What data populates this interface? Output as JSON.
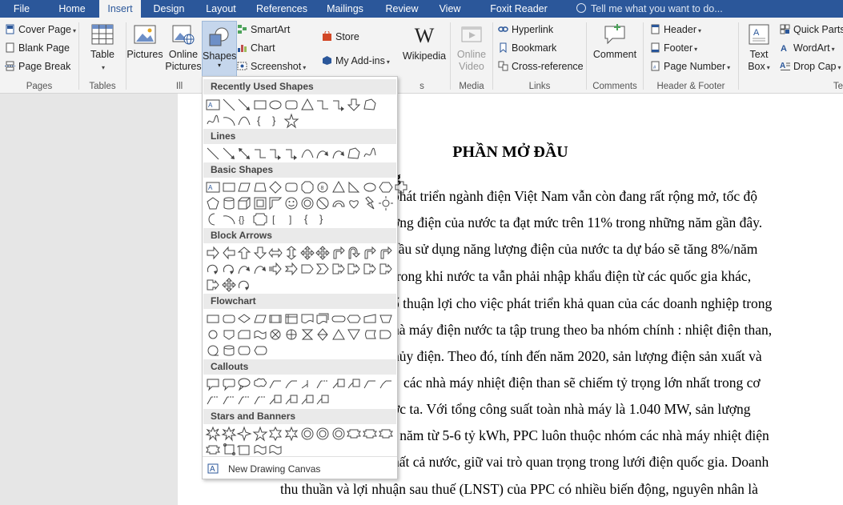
{
  "tabs": [
    "File",
    "Home",
    "Insert",
    "Design",
    "Layout",
    "References",
    "Mailings",
    "Review",
    "View",
    "Foxit Reader PDF"
  ],
  "tell_me": "Tell me what you want to do...",
  "ribbon": {
    "pages": {
      "label": "Pages",
      "cover_page": "Cover Page",
      "blank_page": "Blank Page",
      "page_break": "Page Break"
    },
    "tables": {
      "label": "Tables",
      "table": "Table"
    },
    "illustrations": {
      "label": "Ill",
      "pictures": "Pictures",
      "online_pictures_1": "Online",
      "online_pictures_2": "Pictures",
      "shapes": "Shapes",
      "smartart": "SmartArt",
      "chart": "Chart",
      "screenshot": "Screenshot"
    },
    "addins": {
      "store": "Store",
      "my_addins": "My Add-ins",
      "wikipedia": "Wikipedia",
      "label_tail": "s"
    },
    "media": {
      "label": "Media",
      "online_video_1": "Online",
      "online_video_2": "Video"
    },
    "links": {
      "label": "Links",
      "hyperlink": "Hyperlink",
      "bookmark": "Bookmark",
      "cross_reference": "Cross-reference"
    },
    "comments": {
      "label": "Comments",
      "comment": "Comment"
    },
    "header_footer": {
      "label": "Header & Footer",
      "header": "Header",
      "footer": "Footer",
      "page_number": "Page Number"
    },
    "text": {
      "text_box_1": "Text",
      "text_box_2": "Box",
      "quick_parts": "Quick Parts",
      "wordart": "WordArt",
      "drop_cap": "Drop Cap",
      "label_tail": "Te"
    }
  },
  "shapes_panel": {
    "recent": "Recently Used Shapes",
    "lines": "Lines",
    "basic": "Basic Shapes",
    "block_arrows": "Block Arrows",
    "flowchart": "Flowchart",
    "callouts": "Callouts",
    "stars": "Stars and Banners",
    "new_canvas": "New Drawing Canvas"
  },
  "document": {
    "title": "PHẦN MỞ ĐẦU",
    "heading_tail": "g",
    "lines": [
      "phát triển ngành điện Việt Nam vẫn còn đang rất rộng mở, tốc độ",
      "ợng điện của nước ta đạt mức trên 11% trong những năm gần đây.",
      "cầu sử dụng năng lượng điện của nước ta dự báo sẽ tăng 8%/năm",
      "trong khi nước ta vẫn phải nhập khẩu điện từ các quốc gia khác,",
      "ố thuận lợi cho việc phát triển khả quan của các doanh nghiệp trong",
      "hà máy điện nước ta tập trung theo ba nhóm chính : nhiệt điện than,",
      "hủy điện. Theo đó, tính đến năm 2020, sản lượng điện sản xuất và",
      "các nhà máy nhiệt điện than sẽ chiếm tỷ trọng lớn nhất trong cơ",
      "ớc ta. Với tổng công suất toàn nhà máy là 1.040 MW, sản lượng",
      "i năm từ 5-6 tỷ kWh, PPC luôn thuộc nhóm các nhà máy nhiệt điện",
      "hất cả nước, giữ vai trò quan trọng trong lưới điện quốc gia. Doanh",
      "thu thuần và lợi nhuận sau thuế (LNST) của PPC có nhiều biến động, nguyên nhân là"
    ]
  }
}
